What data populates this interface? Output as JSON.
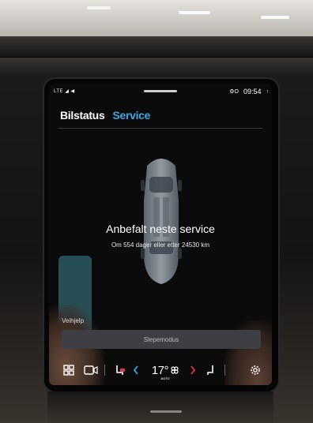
{
  "status_bar": {
    "network": "LTE ◢ ◀",
    "icons": "⚙O",
    "time": "09:54",
    "extra": "↑"
  },
  "tabs": [
    {
      "label": "Bilstatus",
      "active": false
    },
    {
      "label": "Service",
      "active": true
    }
  ],
  "service": {
    "title": "Anbefalt neste service",
    "subtitle": "Om 554 dager eller etter 24530 km"
  },
  "roadside": {
    "label": "Veihjelp",
    "tow_button": "Slepemodus"
  },
  "climate_bar": {
    "temperature": "17°",
    "mode": "AUTO",
    "icons": [
      "apps-grid-icon",
      "camera-icon",
      "seat-heat-left-icon",
      "chevron-left-icon",
      "fan-icon",
      "chevron-right-icon",
      "seat-heat-right-icon",
      "settings-gear-icon"
    ]
  },
  "colors": {
    "accent": "#3fa7e0",
    "background": "#0b0b0c",
    "button": "#3d3f44",
    "left_chevron": "#3fa7e0",
    "right_chevron": "#e0344a"
  }
}
